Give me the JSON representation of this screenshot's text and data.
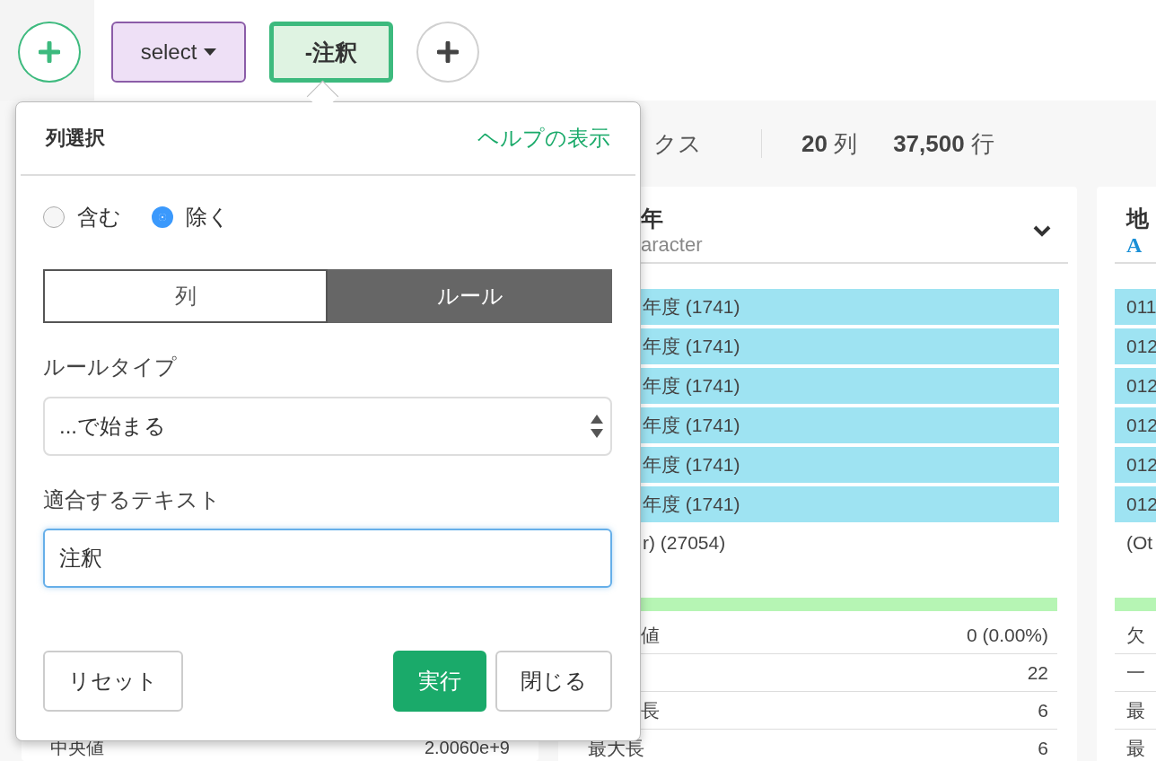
{
  "toolbar": [
    {
      "kind": "add",
      "accent": true
    },
    {
      "kind": "dropdown",
      "label": "select"
    },
    {
      "kind": "step",
      "label": "-注釈",
      "selected": true
    },
    {
      "kind": "add",
      "accent": false
    }
  ],
  "summary": {
    "name": "クス",
    "columns_count": "20",
    "columns_unit": "列",
    "rows_count": "37,500",
    "rows_unit": "行"
  },
  "cards": [
    {
      "stats": [
        {
          "label": "中央値",
          "value": "2.0060e+9"
        }
      ]
    },
    {
      "title": "年",
      "type": "aracter",
      "menu": true,
      "top_values": [
        "年度 (1741)",
        "年度 (1741)",
        "年度 (1741)",
        "年度 (1741)",
        "年度 (1741)",
        "年度 (1741)"
      ],
      "other": "r) (27054)",
      "stats": [
        {
          "label": "値",
          "value": "0 (0.00%)"
        },
        {
          "value": "22"
        },
        {
          "label": "長",
          "value": "6"
        },
        {
          "label": "最大長",
          "value": "6"
        }
      ]
    },
    {
      "title": "地",
      "type_mark": "A",
      "top_values": [
        "011",
        "012",
        "012",
        "012",
        "012",
        "012"
      ],
      "other": "(Ot",
      "stats": [
        {
          "label": "欠"
        },
        {
          "label": "一"
        },
        {
          "label": "最"
        },
        {
          "label": "最"
        }
      ]
    }
  ],
  "popover": {
    "title": "列選択",
    "help_link": "ヘルプの表示",
    "modes": [
      {
        "label": "含む",
        "selected": false
      },
      {
        "label": "除く",
        "selected": true
      }
    ],
    "tabs": [
      {
        "label": "列",
        "selected": false
      },
      {
        "label": "ルール",
        "selected": true
      }
    ],
    "rule_type": {
      "label": "ルールタイプ",
      "value": "...で始まる"
    },
    "match_text": {
      "label": "適合するテキスト",
      "value": "注釈",
      "focused": true
    },
    "buttons": [
      {
        "label": "リセット",
        "kind": "default"
      },
      {
        "label": "実行",
        "kind": "primary"
      },
      {
        "label": "閉じる",
        "kind": "default"
      }
    ]
  }
}
